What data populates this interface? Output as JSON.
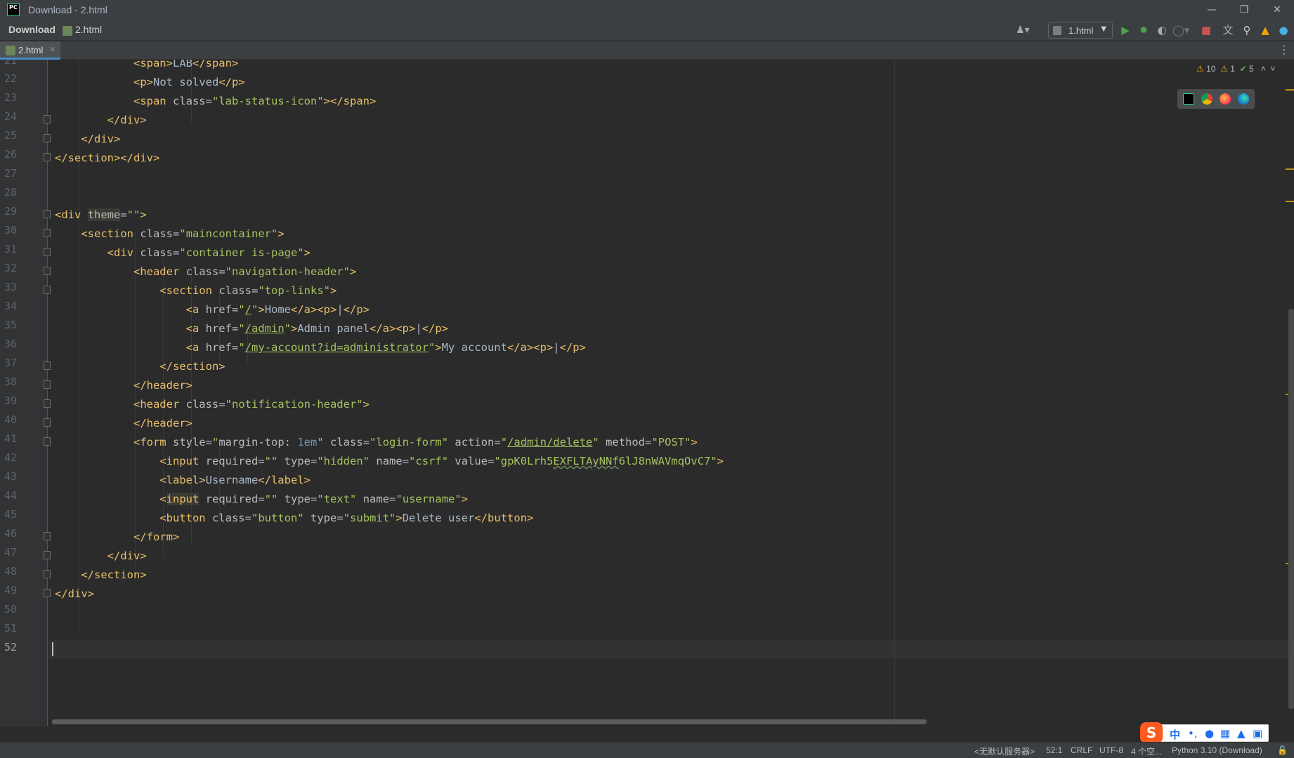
{
  "window": {
    "title": "Download - 2.html",
    "logo_text": "PC"
  },
  "navbar": {
    "project": "Download",
    "file": "2.html",
    "run_config": "1.html"
  },
  "tabs": [
    {
      "label": "2.html",
      "active": true
    }
  ],
  "inspections": {
    "warnings": "10",
    "weak_warnings": "1",
    "typos": "5"
  },
  "editor": {
    "lines": [
      {
        "num": "21",
        "html": "            <span class='tok-tag'>&lt;span&gt;</span>LAB<span class='tok-tag'>&lt;/span&gt;</span>"
      },
      {
        "num": "22",
        "html": "            <span class='tok-tag'>&lt;p&gt;</span>Not solved<span class='tok-tag'>&lt;/p&gt;</span>"
      }
    ],
    "current_line": "52"
  },
  "code": {
    "l21": "LAB",
    "l22": "Not solved",
    "l23_class": "lab-status-icon",
    "l29_attr": "theme",
    "l30_class": "maincontainer",
    "l31_class": "container is-page",
    "l32_class": "navigation-header",
    "l33_class": "top-links",
    "l34_href": "/",
    "l34_text": "Home",
    "l35_href": "/admin",
    "l35_text": "Admin panel",
    "l36_href": "/my-account?id=administrator",
    "l36_text": "My account",
    "l39_class": "notification-header",
    "l41_style": "margin-top: ",
    "l41_style_num": "1em",
    "l41_class": "login-form",
    "l41_action": "/admin/delete",
    "l41_method": "POST",
    "l42_type": "hidden",
    "l42_name": "csrf",
    "l42_value_a": "gpK0Lrh5",
    "l42_value_b": "EXFLTAyNNf",
    "l42_value_c": "6lJ8nWAVmqOvC7",
    "l43_text": "Username",
    "l44_type": "text",
    "l44_name": "username",
    "l45_class": "button",
    "l45_type": "submit",
    "l45_text": "Delete user"
  },
  "statusbar": {
    "server": "<无默认服务器>",
    "position": "52:1",
    "line_sep": "CRLF",
    "encoding": "UTF-8",
    "indent": "4 个空...",
    "interpreter": "Python 3.10 (Download)"
  },
  "ime": {
    "logo": "S",
    "mode": "中",
    "punct": "•,"
  }
}
